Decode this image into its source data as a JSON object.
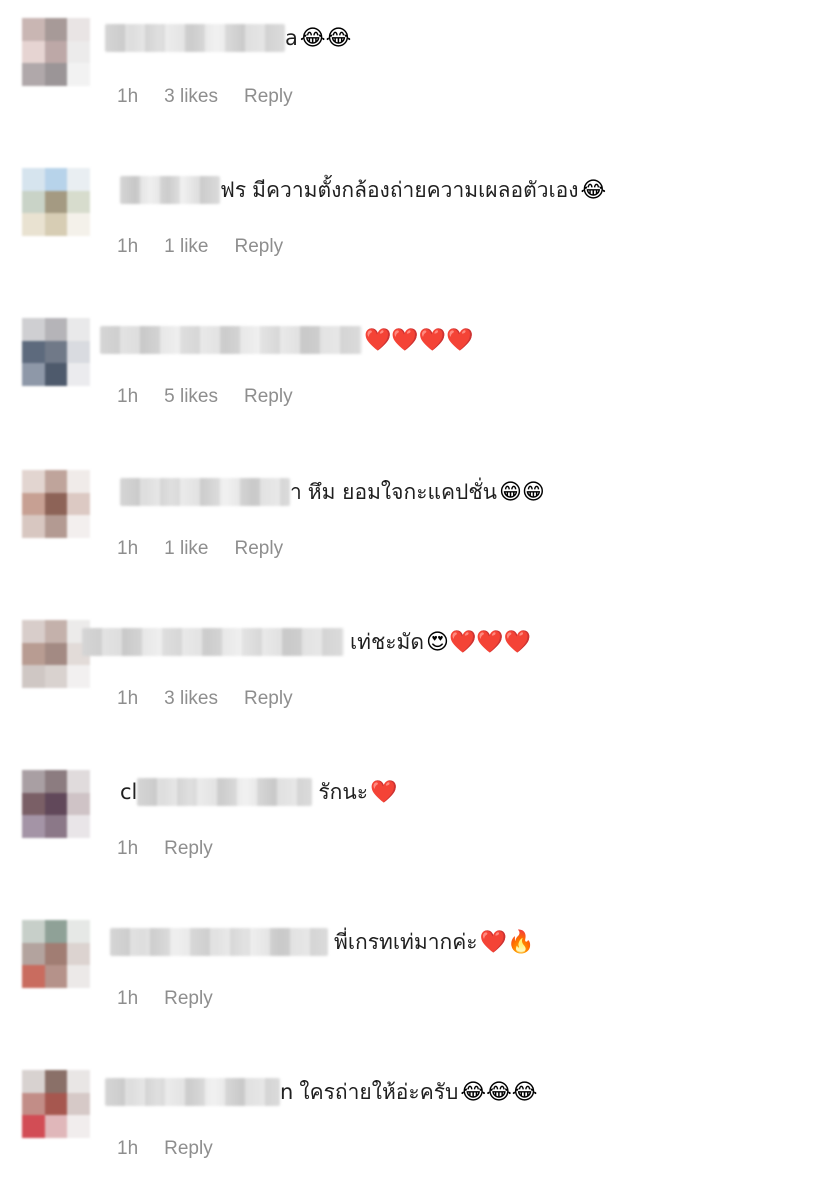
{
  "comments": [
    {
      "name_lead": "",
      "name_tail": "a",
      "text": "",
      "emojis": "😂😂",
      "time": "1h",
      "likes": "3 likes",
      "reply": "Reply",
      "avatar_colors": [
        "#c9b6b3",
        "#a79a98",
        "#e9e4e4",
        "#e6d4d2",
        "#bda8a7",
        "#ecebeb",
        "#b0a8aa",
        "#9b9597",
        "#f2f2f2"
      ]
    },
    {
      "name_lead": "",
      "name_tail": "ฟร",
      "text": "มีความตั้งกล้องถ่ายความเผลอตัวเอง",
      "emojis": "😂",
      "time": "1h",
      "likes": "1 like",
      "reply": "Reply",
      "avatar_colors": [
        "#d6e4ee",
        "#b7d3ea",
        "#e9eef2",
        "#c9d3c7",
        "#a49a82",
        "#d7dccd",
        "#e9e2d1",
        "#d7cdb4",
        "#f4f1ea"
      ]
    },
    {
      "name_lead": "",
      "name_tail": "",
      "text": "",
      "emojis": "❤️❤️❤️❤️",
      "time": "1h",
      "likes": "5 likes",
      "reply": "Reply",
      "avatar_colors": [
        "#cfcfd2",
        "#b5b4b8",
        "#e9e9ea",
        "#5d6a7d",
        "#707988",
        "#d9dbe0",
        "#8e98a8",
        "#4e5a6c",
        "#ebebee"
      ]
    },
    {
      "name_lead": "",
      "name_tail": "า",
      "text": "หึม ยอมใจกะแคปชั่น",
      "emojis": "😁😁",
      "time": "1h",
      "likes": "1 like",
      "reply": "Reply",
      "avatar_colors": [
        "#e2d5d0",
        "#bfa49b",
        "#f0ebe9",
        "#c7a093",
        "#8d6357",
        "#dcc9c3",
        "#d8c7c1",
        "#b39a92",
        "#f3efee"
      ]
    },
    {
      "name_lead": "",
      "name_tail": "",
      "text": "เท่ชะมัด",
      "emojis": "😍❤️❤️❤️",
      "time": "1h",
      "likes": "3 likes",
      "reply": "Reply",
      "avatar_colors": [
        "#d8cdca",
        "#c4b1ab",
        "#ecebea",
        "#b89c92",
        "#a38a83",
        "#e2dbd8",
        "#cfc7c4",
        "#d9d2cf",
        "#f2f0f0"
      ]
    },
    {
      "name_lead": "cl",
      "name_tail": "",
      "text": "รักนะ",
      "emojis": "❤️",
      "time": "1h",
      "likes": "",
      "reply": "Reply",
      "avatar_colors": [
        "#a99fa3",
        "#8c7c80",
        "#e0dbdc",
        "#7a5f66",
        "#61485a",
        "#cfc3c6",
        "#a494a6",
        "#8b7888",
        "#e9e5e8"
      ]
    },
    {
      "name_lead": "",
      "name_tail": "",
      "text": "พี่เกรทเท่มากค่ะ",
      "emojis": "❤️🔥",
      "time": "1h",
      "likes": "",
      "reply": "Reply",
      "avatar_colors": [
        "#c7cfc9",
        "#8fa197",
        "#e6e8e6",
        "#b3a39e",
        "#a17d73",
        "#dcd3d0",
        "#c96c5f",
        "#b5928a",
        "#ece9e8"
      ]
    },
    {
      "name_lead": "",
      "name_tail": "n",
      "text": "ใครถ่ายให้อ่ะครับ",
      "emojis": "😂😂😂",
      "time": "1h",
      "likes": "",
      "reply": "Reply",
      "avatar_colors": [
        "#d8d2d0",
        "#8a7068",
        "#e9e6e5",
        "#c28d87",
        "#a6574f",
        "#d6c9c7",
        "#d24d55",
        "#e0b7ba",
        "#f1eded"
      ]
    }
  ]
}
